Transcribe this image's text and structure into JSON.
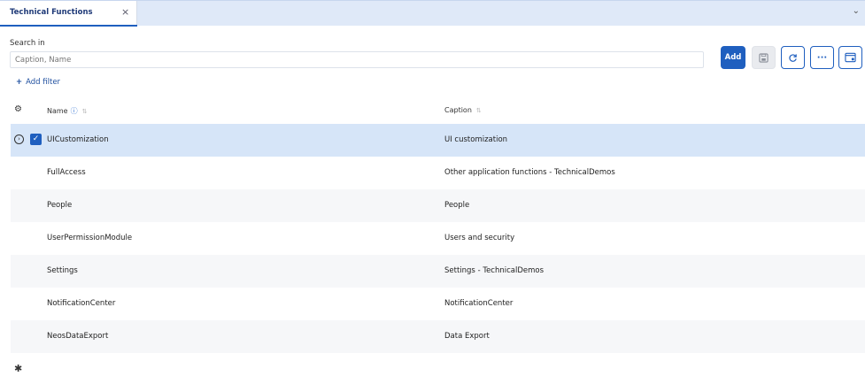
{
  "tab": {
    "label": "Technical Functions",
    "close_glyph": "×",
    "chevron_glyph": "⌄"
  },
  "search": {
    "label": "Search in",
    "placeholder": "Caption, Name",
    "value": ""
  },
  "toolbar": {
    "add_label": "Add",
    "save_icon": "save-icon",
    "refresh_icon": "refresh-icon",
    "more_glyph": "···",
    "settings_icon": "settings-panel-icon"
  },
  "filter": {
    "add_label": "Add filter",
    "plus_glyph": "+"
  },
  "table": {
    "columns": [
      {
        "label": "Name",
        "info_glyph": "ⓘ",
        "sort_glyph": "⇅"
      },
      {
        "label": "Caption",
        "sort_glyph": "⇅"
      }
    ],
    "rows": [
      {
        "name": "UICustomization",
        "caption": "UI customization",
        "selected": true,
        "checked": true
      },
      {
        "name": "FullAccess",
        "caption": "Other application functions - TechnicalDemos"
      },
      {
        "name": "People",
        "caption": "People"
      },
      {
        "name": "UserPermissionModule",
        "caption": "Users and security"
      },
      {
        "name": "Settings",
        "caption": "Settings - TechnicalDemos"
      },
      {
        "name": "NotificationCenter",
        "caption": "NotificationCenter"
      },
      {
        "name": "NeosDataExport",
        "caption": "Data Export"
      }
    ],
    "new_row_glyph": "✱",
    "expand_glyph": "›",
    "check_glyph": "✓",
    "gear_glyph": "⚙"
  },
  "colors": {
    "accent": "#1f5fbf",
    "selected_row": "#d6e5f8",
    "tabbar": "#dfe9f8"
  }
}
